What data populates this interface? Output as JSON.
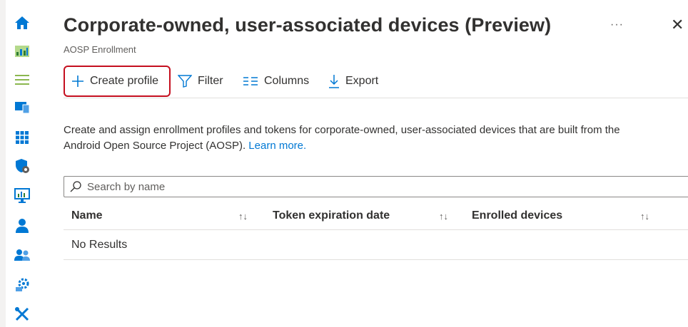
{
  "sidebar": {
    "icons": [
      {
        "name": "home-icon"
      },
      {
        "name": "dashboard-icon"
      },
      {
        "name": "all-services-icon"
      },
      {
        "name": "devices-icon"
      },
      {
        "name": "apps-icon"
      },
      {
        "name": "endpoint-security-icon"
      },
      {
        "name": "reports-icon"
      },
      {
        "name": "users-icon"
      },
      {
        "name": "groups-icon"
      },
      {
        "name": "tenant-administration-icon"
      },
      {
        "name": "troubleshooting-icon"
      }
    ]
  },
  "header": {
    "title": "Corporate-owned, user-associated devices (Preview)",
    "subtitle": "AOSP Enrollment",
    "more_label": "···",
    "close_label": "✕"
  },
  "toolbar": {
    "create_label": "Create profile",
    "filter_label": "Filter",
    "columns_label": "Columns",
    "export_label": "Export"
  },
  "description": {
    "text": "Create and assign enrollment profiles and tokens for corporate-owned, user-associated devices that are built from the",
    "text2": "Android Open Source Project (AOSP). ",
    "link": "Learn more."
  },
  "search": {
    "placeholder": "Search by name"
  },
  "table": {
    "columns": [
      "Name",
      "Token expiration date",
      "Enrolled devices"
    ],
    "sort_glyph": "↑↓",
    "empty_text": "No Results"
  },
  "colors": {
    "accent": "#0078d4",
    "highlight_border": "#c50f1f"
  }
}
